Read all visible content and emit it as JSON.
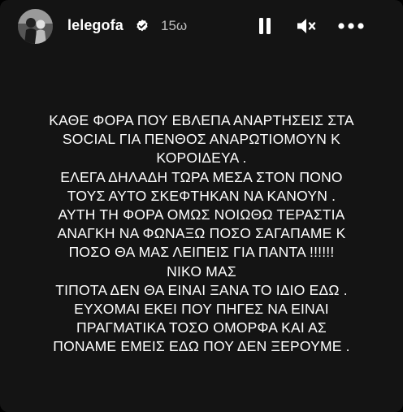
{
  "header": {
    "username": "lelegofa",
    "verified_icon": "verified-badge-icon",
    "timestamp": "15ω",
    "controls": {
      "pause_icon": "pause-icon",
      "mute_icon": "muted-speaker-icon",
      "more_icon": "more-options-icon"
    }
  },
  "story": {
    "lines": [
      "ΚΑΘΕ ΦΟΡΑ ΠΟΥ ΕΒΛΕΠΑ ΑΝΑΡΤΗΣΕΙΣ ΣΤΑ",
      "SOCIAL ΓΙΑ ΠΕΝΘΟΣ ΑΝΑΡΩΤΙΟΜΟΥΝ Κ",
      "ΚΟΡΟΙΔΕΥΑ .",
      "ΕΛΕΓΑ ΔΗΛΑΔΗ ΤΩΡΑ ΜΕΣΑ ΣΤΟΝ ΠΟΝΟ",
      "ΤΟΥΣ ΑΥΤΟ ΣΚΕΦΤΗΚΑΝ ΝΑ ΚΑΝΟΥΝ .",
      "ΑΥΤΗ ΤΗ ΦΟΡΑ ΟΜΩΣ ΝΟΙΩΘΩ ΤΕΡΑΣΤΙΑ",
      "ΑΝΑΓΚΗ ΝΑ ΦΩΝΑΞΩ ΠΟΣΟ ΣΑΓΑΠΑΜΕ Κ",
      "ΠΟΣΟ ΘΑ ΜΑΣ ΛΕΙΠΕΙΣ ΓΙΑ ΠΑΝΤΑ !!!!!!",
      "ΝΙΚΟ ΜΑΣ",
      "ΤΙΠΟΤΑ ΔΕΝ ΘΑ ΕΙΝΑΙ ΞΑΝΑ ΤΟ ΙΔΙΟ ΕΔΩ .",
      "ΕΥΧΟΜΑΙ ΕΚΕΙ ΠΟΥ ΠΗΓΕΣ ΝΑ ΕΙΝΑΙ",
      "ΠΡΑΓΜΑΤΙΚΑ ΤΟΣΟ ΟΜΟΡΦΑ ΚΑΙ ΑΣ",
      "ΠΟΝΑΜΕ ΕΜΕΙΣ ΕΔΩ ΠΟΥ ΔΕΝ ΞΕΡΟΥΜΕ ."
    ]
  },
  "colors": {
    "background": "#141414",
    "text": "#ffffff",
    "timestamp": "#bdbdbd"
  }
}
